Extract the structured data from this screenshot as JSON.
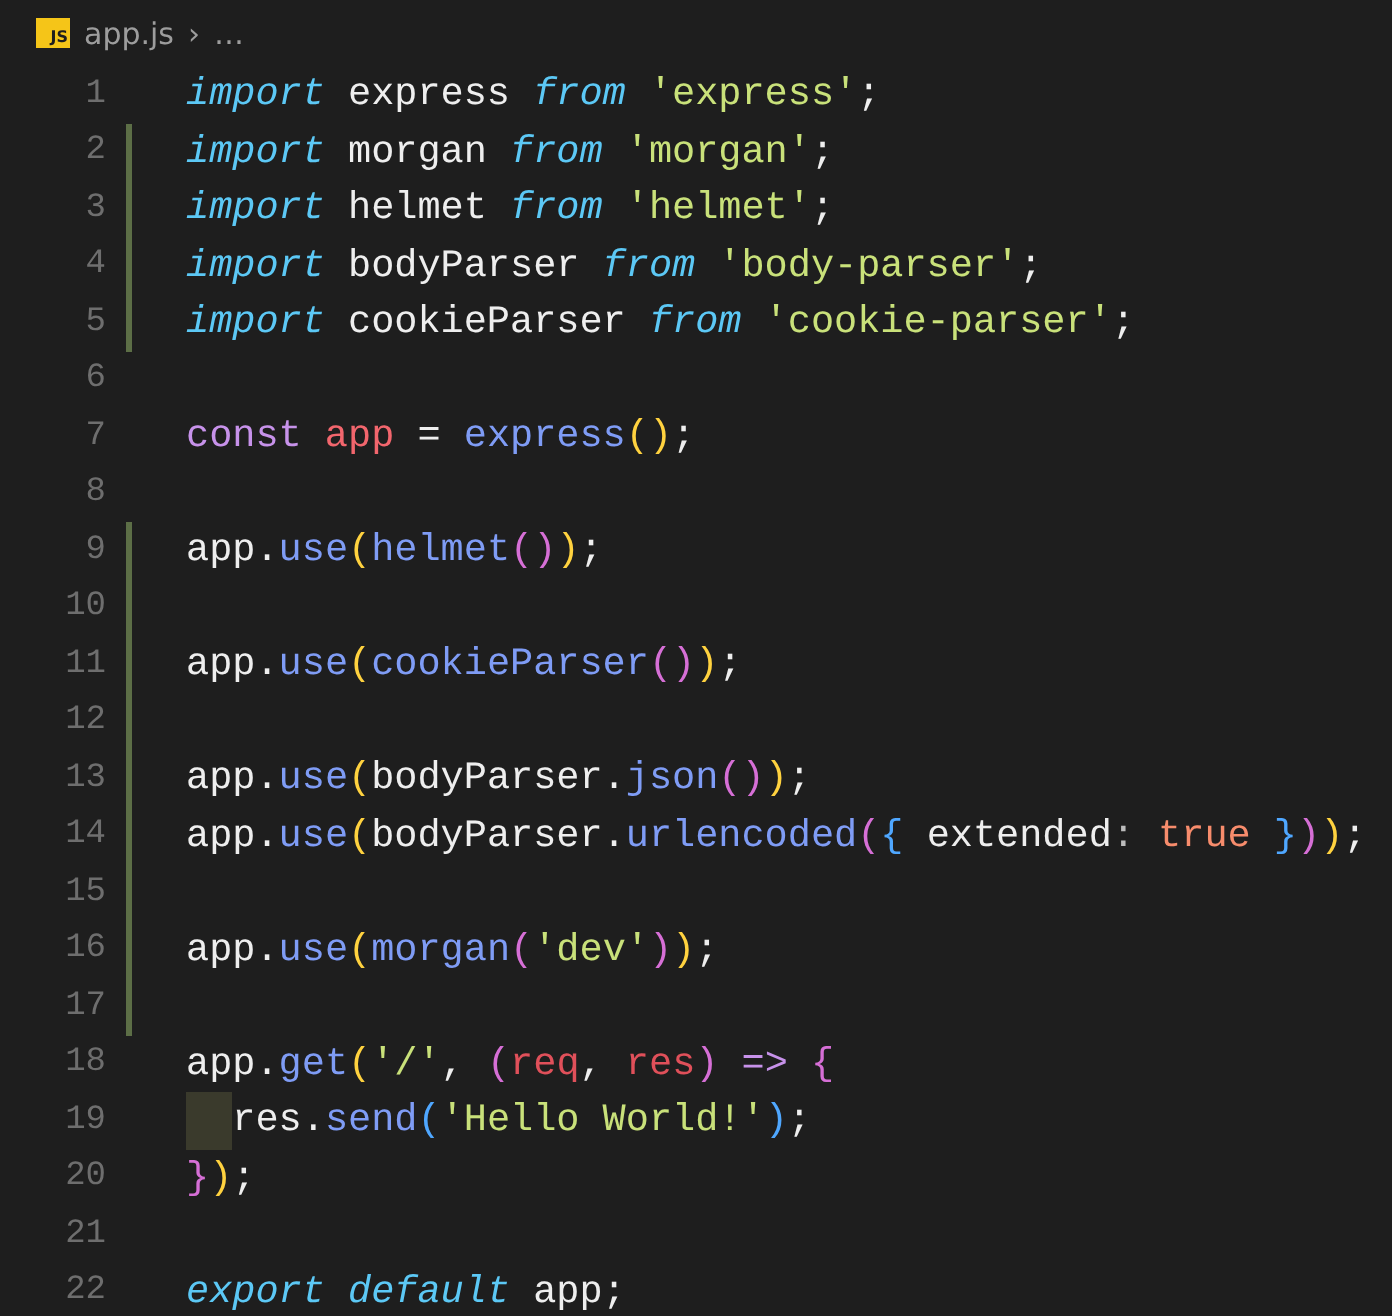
{
  "breadcrumb": {
    "icon_label": "JS",
    "file": "app.js",
    "separator": "›",
    "rest": "…"
  },
  "lines": [
    {
      "number": "1",
      "changed": false,
      "tokens": [
        {
          "kind": "kw",
          "text": "import"
        },
        {
          "kind": "id",
          "text": " express "
        },
        {
          "kind": "kw",
          "text": "from"
        },
        {
          "kind": "str",
          "text": " 'express'"
        },
        {
          "kind": "id",
          "text": ";"
        }
      ]
    },
    {
      "number": "2",
      "changed": true,
      "tokens": [
        {
          "kind": "kw",
          "text": "import"
        },
        {
          "kind": "id",
          "text": " morgan "
        },
        {
          "kind": "kw",
          "text": "from"
        },
        {
          "kind": "str",
          "text": " 'morgan'"
        },
        {
          "kind": "id",
          "text": ";"
        }
      ]
    },
    {
      "number": "3",
      "changed": true,
      "tokens": [
        {
          "kind": "kw",
          "text": "import"
        },
        {
          "kind": "id",
          "text": " helmet "
        },
        {
          "kind": "kw",
          "text": "from"
        },
        {
          "kind": "str",
          "text": " 'helmet'"
        },
        {
          "kind": "id",
          "text": ";"
        }
      ]
    },
    {
      "number": "4",
      "changed": true,
      "tokens": [
        {
          "kind": "kw",
          "text": "import"
        },
        {
          "kind": "id",
          "text": " bodyParser "
        },
        {
          "kind": "kw",
          "text": "from"
        },
        {
          "kind": "str",
          "text": " 'body-parser'"
        },
        {
          "kind": "id",
          "text": ";"
        }
      ]
    },
    {
      "number": "5",
      "changed": true,
      "tokens": [
        {
          "kind": "kw",
          "text": "import"
        },
        {
          "kind": "id",
          "text": " cookieParser "
        },
        {
          "kind": "kw",
          "text": "from"
        },
        {
          "kind": "str",
          "text": " 'cookie-parser'"
        },
        {
          "kind": "id",
          "text": ";"
        }
      ]
    },
    {
      "number": "6",
      "changed": false
    },
    {
      "number": "7",
      "changed": false,
      "tokens": [
        {
          "kind": "storage",
          "text": "const"
        },
        {
          "kind": "var",
          "text": " app"
        },
        {
          "kind": "id",
          "text": " = "
        },
        {
          "kind": "fn",
          "text": "express"
        },
        {
          "kind": "br1",
          "text": "()"
        },
        {
          "kind": "id",
          "text": ";"
        }
      ]
    },
    {
      "number": "8",
      "changed": false
    },
    {
      "number": "9",
      "changed": true,
      "tokens": [
        {
          "kind": "id",
          "text": "app."
        },
        {
          "kind": "fn",
          "text": "use"
        },
        {
          "kind": "br1",
          "text": "("
        },
        {
          "kind": "fn",
          "text": "helmet"
        },
        {
          "kind": "br2",
          "text": "()"
        },
        {
          "kind": "br1",
          "text": ")"
        },
        {
          "kind": "id",
          "text": ";"
        }
      ]
    },
    {
      "number": "10",
      "changed": true
    },
    {
      "number": "11",
      "changed": true,
      "tokens": [
        {
          "kind": "id",
          "text": "app."
        },
        {
          "kind": "fn",
          "text": "use"
        },
        {
          "kind": "br1",
          "text": "("
        },
        {
          "kind": "fn",
          "text": "cookieParser"
        },
        {
          "kind": "br2",
          "text": "()"
        },
        {
          "kind": "br1",
          "text": ")"
        },
        {
          "kind": "id",
          "text": ";"
        }
      ]
    },
    {
      "number": "12",
      "changed": true
    },
    {
      "number": "13",
      "changed": true,
      "tokens": [
        {
          "kind": "id",
          "text": "app."
        },
        {
          "kind": "fn",
          "text": "use"
        },
        {
          "kind": "br1",
          "text": "("
        },
        {
          "kind": "id",
          "text": "bodyParser."
        },
        {
          "kind": "fn",
          "text": "json"
        },
        {
          "kind": "br2",
          "text": "()"
        },
        {
          "kind": "br1",
          "text": ")"
        },
        {
          "kind": "id",
          "text": ";"
        }
      ]
    },
    {
      "number": "14",
      "changed": true,
      "tokens": [
        {
          "kind": "id",
          "text": "app."
        },
        {
          "kind": "fn",
          "text": "use"
        },
        {
          "kind": "br1",
          "text": "("
        },
        {
          "kind": "id",
          "text": "bodyParser."
        },
        {
          "kind": "fn",
          "text": "urlencoded"
        },
        {
          "kind": "br2",
          "text": "("
        },
        {
          "kind": "br3",
          "text": "{"
        },
        {
          "kind": "id",
          "text": " extended"
        },
        {
          "kind": "punct",
          "text": ": "
        },
        {
          "kind": "bool",
          "text": "true"
        },
        {
          "kind": "br3",
          "text": " }"
        },
        {
          "kind": "br2",
          "text": ")"
        },
        {
          "kind": "br1",
          "text": ")"
        },
        {
          "kind": "id",
          "text": ";"
        }
      ]
    },
    {
      "number": "15",
      "changed": true
    },
    {
      "number": "16",
      "changed": true,
      "tokens": [
        {
          "kind": "id",
          "text": "app."
        },
        {
          "kind": "fn",
          "text": "use"
        },
        {
          "kind": "br1",
          "text": "("
        },
        {
          "kind": "fn",
          "text": "morgan"
        },
        {
          "kind": "br2",
          "text": "("
        },
        {
          "kind": "str",
          "text": "'dev'"
        },
        {
          "kind": "br2",
          "text": ")"
        },
        {
          "kind": "br1",
          "text": ")"
        },
        {
          "kind": "id",
          "text": ";"
        }
      ]
    },
    {
      "number": "17",
      "changed": true
    },
    {
      "number": "18",
      "changed": false,
      "tokens": [
        {
          "kind": "id",
          "text": "app."
        },
        {
          "kind": "fn",
          "text": "get"
        },
        {
          "kind": "br1",
          "text": "("
        },
        {
          "kind": "str",
          "text": "'/'"
        },
        {
          "kind": "id",
          "text": ", "
        },
        {
          "kind": "br2",
          "text": "("
        },
        {
          "kind": "param",
          "text": "req"
        },
        {
          "kind": "id",
          "text": ", "
        },
        {
          "kind": "param",
          "text": "res"
        },
        {
          "kind": "br2",
          "text": ")"
        },
        {
          "kind": "storage",
          "text": " =>"
        },
        {
          "kind": "br2",
          "text": " {"
        }
      ]
    },
    {
      "number": "19",
      "changed": false,
      "indented": true,
      "tokens": [
        {
          "kind": "id",
          "text": "res."
        },
        {
          "kind": "fn",
          "text": "send"
        },
        {
          "kind": "br3",
          "text": "("
        },
        {
          "kind": "str",
          "text": "'Hello World!'"
        },
        {
          "kind": "br3",
          "text": ")"
        },
        {
          "kind": "id",
          "text": ";"
        }
      ]
    },
    {
      "number": "20",
      "changed": false,
      "tokens": [
        {
          "kind": "br2",
          "text": "}"
        },
        {
          "kind": "br1",
          "text": ")"
        },
        {
          "kind": "id",
          "text": ";"
        }
      ]
    },
    {
      "number": "21",
      "changed": false
    },
    {
      "number": "22",
      "changed": false,
      "tokens": [
        {
          "kind": "kw",
          "text": "export"
        },
        {
          "kind": "kw",
          "text": " default"
        },
        {
          "kind": "id",
          "text": " app;"
        }
      ]
    }
  ]
}
